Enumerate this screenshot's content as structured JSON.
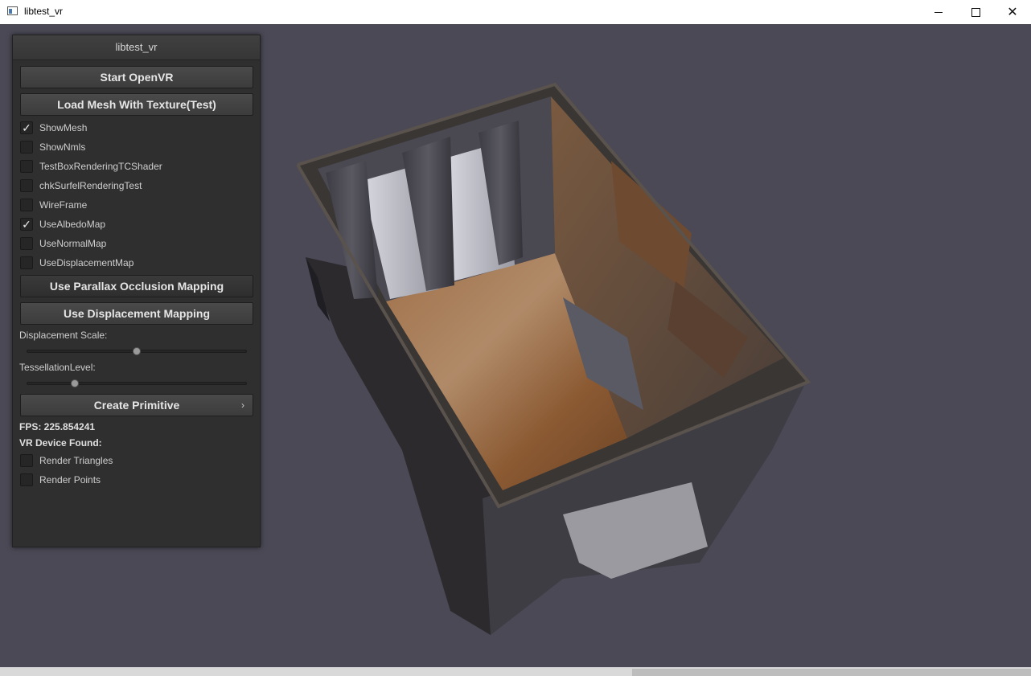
{
  "window": {
    "title": "libtest_vr",
    "minimize_label": "–",
    "close_label": "✕"
  },
  "panel": {
    "title": "libtest_vr",
    "start_openvr_label": "Start OpenVR",
    "load_mesh_label": "Load Mesh With Texture(Test)",
    "checkboxes": [
      {
        "label": "ShowMesh",
        "checked": true
      },
      {
        "label": "ShowNmls",
        "checked": false
      },
      {
        "label": "TestBoxRenderingTCShader",
        "checked": false
      },
      {
        "label": "chkSurfelRenderingTest",
        "checked": false
      },
      {
        "label": "WireFrame",
        "checked": false
      },
      {
        "label": "UseAlbedoMap",
        "checked": true
      },
      {
        "label": "UseNormalMap",
        "checked": false
      },
      {
        "label": "UseDisplacementMap",
        "checked": false
      }
    ],
    "parallax_label": "Use Parallax Occlusion Mapping",
    "displacement_mapping_label": "Use Displacement Mapping",
    "displacement_scale": {
      "label": "Displacement Scale:",
      "value": 0.5
    },
    "tessellation_level": {
      "label": "TessellationLevel:",
      "value": 0.22
    },
    "create_primitive_label": "Create Primitive",
    "create_primitive_arrow": "›",
    "fps_text": "FPS: 225.854241",
    "vr_device_text": "VR Device Found:",
    "render_checkboxes": [
      {
        "label": "Render Triangles",
        "checked": false
      },
      {
        "label": "Render Points",
        "checked": false
      }
    ],
    "check_glyph": "✓"
  },
  "colors": {
    "viewport_bg": "#4a4955",
    "panel_bg": "#2f2f2f",
    "floor": "#8a5a35",
    "walls": "#3a3838"
  }
}
